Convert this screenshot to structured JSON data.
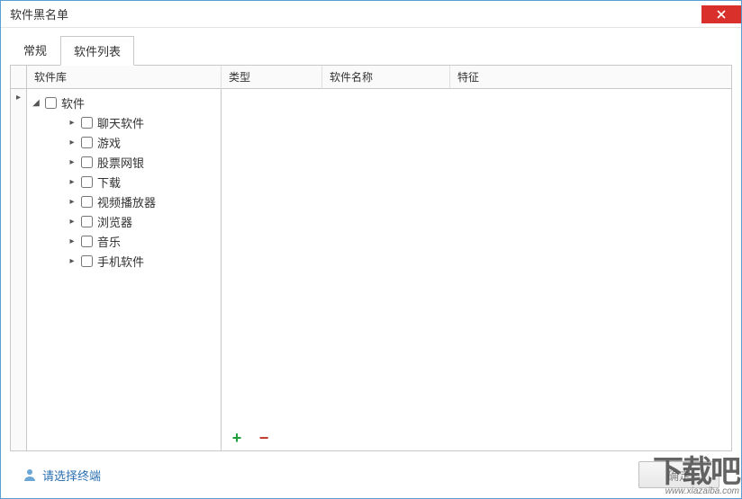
{
  "window": {
    "title": "软件黑名单"
  },
  "tabs": [
    {
      "id": "general",
      "label": "常规",
      "active": false
    },
    {
      "id": "softlist",
      "label": "软件列表",
      "active": true
    }
  ],
  "columns": {
    "library": "软件库",
    "type": "类型",
    "name": "软件名称",
    "feature": "特征"
  },
  "tree": {
    "root": {
      "label": "软件",
      "expanded": true,
      "checked": false
    },
    "children": [
      {
        "label": "聊天软件",
        "checked": false
      },
      {
        "label": "游戏",
        "checked": false
      },
      {
        "label": "股票网银",
        "checked": false
      },
      {
        "label": "下载",
        "checked": false
      },
      {
        "label": "视频播放器",
        "checked": false
      },
      {
        "label": "浏览器",
        "checked": false
      },
      {
        "label": "音乐",
        "checked": false
      },
      {
        "label": "手机软件",
        "checked": false
      }
    ]
  },
  "toolbar": {
    "add_icon": "add-icon",
    "remove_icon": "minus-icon"
  },
  "footer": {
    "link_label": "请选择终端",
    "ok_label": "确定"
  },
  "watermark": {
    "big": "下载吧",
    "small": "www.xiazaiba.com"
  }
}
